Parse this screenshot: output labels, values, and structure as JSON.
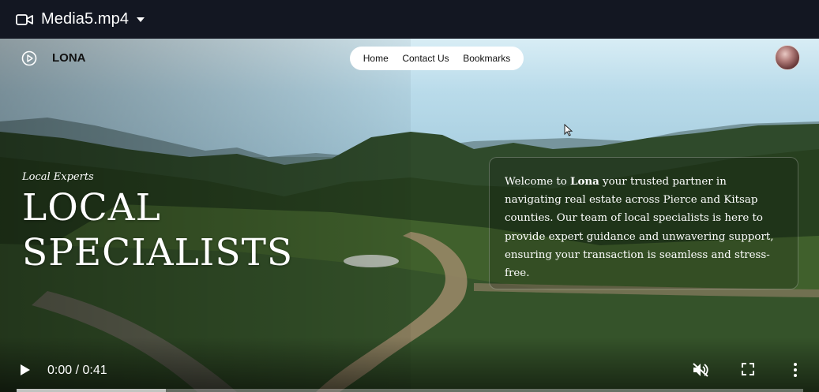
{
  "window": {
    "filename": "Media5.mp4"
  },
  "site": {
    "brand": "LONA",
    "nav": [
      "Home",
      "Contact Us",
      "Bookmarks"
    ]
  },
  "hero": {
    "kicker": "Local Experts",
    "headline_line1": "LOCAL",
    "headline_line2": "SPECIALISTS",
    "intro_prefix": "Welcome to ",
    "intro_brand": "Lona",
    "intro_rest": " your trusted partner in navigating real estate across Pierce and Kitsap counties. Our team of local specialists is here to provide expert guidance and unwavering support, ensuring your transaction is seamless and stress-free."
  },
  "player": {
    "time": "0:00 / 0:41",
    "buffered_fraction": 0.19,
    "icons": [
      "play-icon",
      "mute-icon",
      "fullscreen-icon",
      "more-options-icon"
    ]
  },
  "colors": {
    "titlebar": "#131722",
    "accent": "#ffffff"
  }
}
